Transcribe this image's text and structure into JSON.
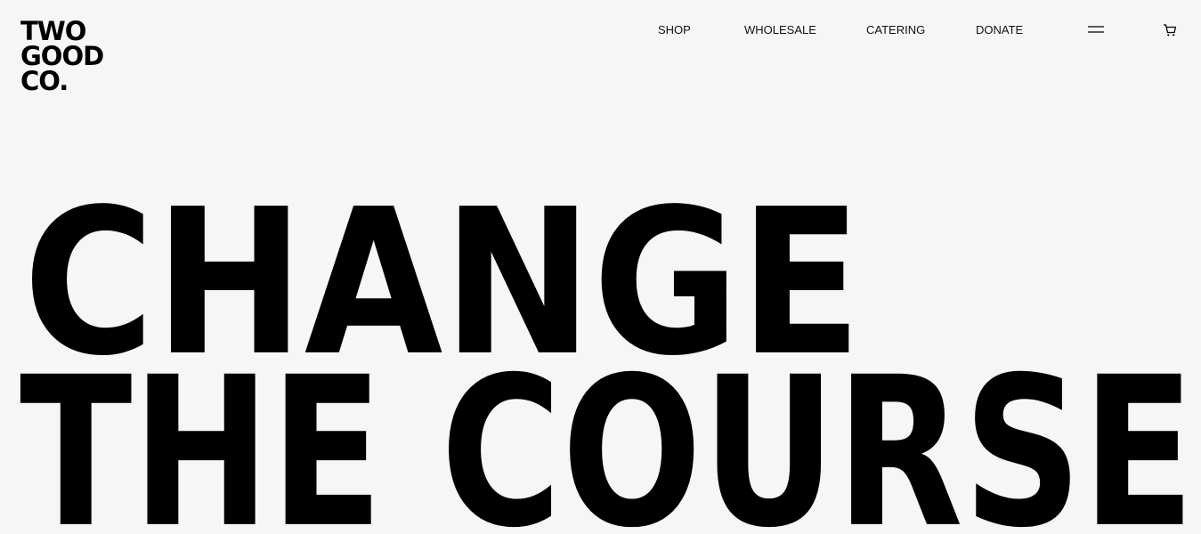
{
  "header": {
    "logo_lines": [
      "TWO",
      "GOOD",
      "CO."
    ],
    "nav": [
      {
        "label": "SHOP"
      },
      {
        "label": "WHOLESALE"
      },
      {
        "label": "CATERING"
      },
      {
        "label": "DONATE"
      }
    ],
    "menu_icon": "hamburger-menu-icon",
    "cart_icon": "shopping-cart-icon"
  },
  "hero": {
    "line1": "CHANGE",
    "line2": "THE COURSE"
  },
  "colors": {
    "background": "#f6f6f6",
    "text": "#000000"
  }
}
